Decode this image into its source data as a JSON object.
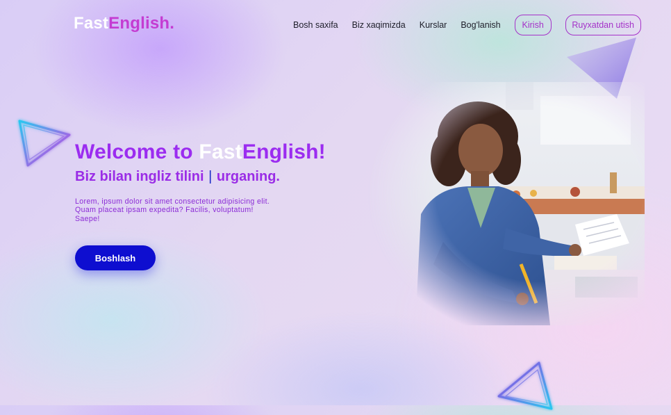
{
  "header": {
    "logo": {
      "part1": "Fast",
      "part2": "English",
      "dot": "."
    },
    "nav": [
      {
        "label": "Bosh saxifa"
      },
      {
        "label": "Biz xaqimizda"
      },
      {
        "label": "Kurslar"
      },
      {
        "label": "Bog'lanish"
      }
    ],
    "login_label": "Kirish",
    "register_label": "Ruyxatdan utish"
  },
  "hero": {
    "title_prefix": "Welcome to ",
    "title_fast": "Fast",
    "title_english": "English!",
    "subtitle_part1": "Biz bilan ingliz tilini ",
    "subtitle_cursor": "|",
    "subtitle_part2": " urganing.",
    "description": "Lorem, ipsum dolor sit amet consectetur adipisicing elit. Quam placeat ipsam expedita? Facilis, voluptatum! Saepe!",
    "cta_label": "Boshlash"
  },
  "colors": {
    "accent_purple": "#9b2cf0",
    "logo_magenta": "#c43cd2",
    "cta_blue": "#0e0ed0",
    "outline_button": "#a531c9"
  },
  "icons": {
    "decoration_top_right": "triangle-icon",
    "decoration_left": "neon-play-triangle-icon",
    "decoration_bottom": "neon-triangle-icon"
  }
}
